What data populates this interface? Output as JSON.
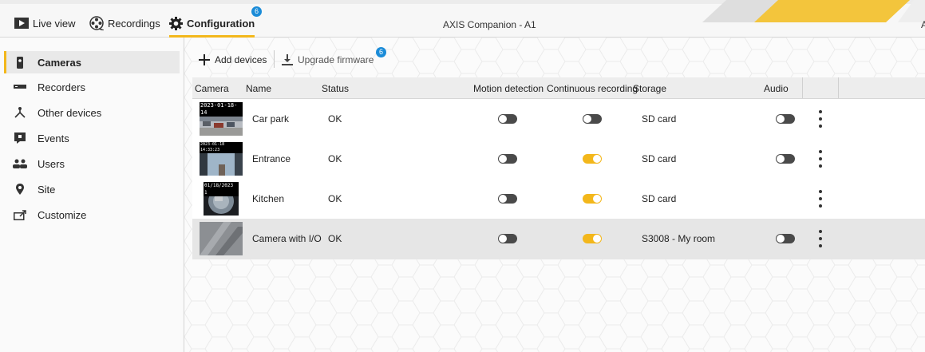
{
  "topbar": {
    "tabs": [
      {
        "label": "Live view",
        "icon": "live-view-icon"
      },
      {
        "label": "Recordings",
        "icon": "film-reel-icon"
      },
      {
        "label": "Configuration",
        "icon": "gear-icon",
        "badge": "6",
        "active": true
      }
    ],
    "app_title": "AXIS Companion - A1",
    "edge_text": "A",
    "accent_color": "#f3b71b"
  },
  "sidebar": {
    "items": [
      {
        "label": "Cameras",
        "icon": "camera-icon",
        "active": true
      },
      {
        "label": "Recorders",
        "icon": "recorder-icon"
      },
      {
        "label": "Other devices",
        "icon": "other-devices-icon"
      },
      {
        "label": "Events",
        "icon": "events-icon"
      },
      {
        "label": "Users",
        "icon": "users-icon"
      },
      {
        "label": "Site",
        "icon": "location-pin-icon"
      },
      {
        "label": "Customize",
        "icon": "customize-icon"
      }
    ]
  },
  "toolbar": {
    "add_devices": "Add devices",
    "upgrade_firmware": "Upgrade firmware",
    "upgrade_badge": "6"
  },
  "table": {
    "columns": [
      "Camera",
      "Name",
      "Status",
      "Motion detection",
      "Continuous recording",
      "Storage",
      "Audio"
    ],
    "rows": [
      {
        "thumb_ts": "2023-01-18-14",
        "name": "Car park",
        "status": "OK",
        "motion": false,
        "continuous": false,
        "storage": "SD card",
        "audio": false,
        "selected": false
      },
      {
        "thumb_ts": "2023-01-18 14:33:23",
        "name": "Entrance",
        "status": "OK",
        "motion": false,
        "continuous": true,
        "storage": "SD card",
        "audio": false,
        "selected": false
      },
      {
        "thumb_ts": "01/18/2023 1",
        "name": "Kitchen",
        "status": "OK",
        "motion": false,
        "continuous": true,
        "storage": "SD card",
        "audio": null,
        "selected": false
      },
      {
        "thumb_ts": "",
        "name": "Camera with I/O",
        "status": "OK",
        "motion": false,
        "continuous": true,
        "storage": "S3008 - My room",
        "audio": false,
        "selected": true
      }
    ]
  }
}
